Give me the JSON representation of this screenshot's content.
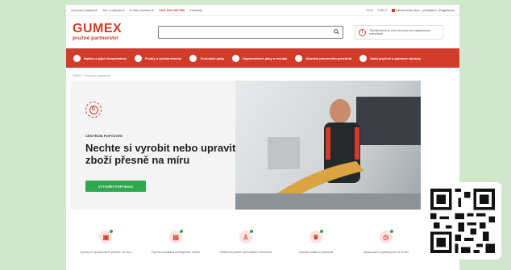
{
  "topbar": {
    "links": [
      "Centrum poptávek",
      "Vše o nákupu ▾",
      "O nás a kariéra ▾"
    ],
    "phone": "+420 518 399 588",
    "contact": "Kontakty",
    "lang": "CZ ▾",
    "currency": "CZK ▾",
    "account": "Zákaznická zóna - přihlášení | Registrace"
  },
  "header": {
    "logo_main": "GUMEX",
    "logo_sub": "pružné partnerství",
    "search_placeholder": "",
    "notice": "Tlačítka zboží je plně za pucze pro registrované pobočkách"
  },
  "nav": [
    {
      "label": "Hadice a jejich komplektace",
      "icon": "hose-icon"
    },
    {
      "label": "Profily a výroba těsnění",
      "icon": "profile-icon"
    },
    {
      "label": "Technické pláty",
      "icon": "sheet-icon"
    },
    {
      "label": "Dopravníkové pásy a montáž",
      "icon": "conveyor-icon"
    },
    {
      "label": "Obuvání pracovního prostředí",
      "icon": "workwear-icon"
    },
    {
      "label": "Další pryžové a plastové výrobky",
      "icon": "rubber-icon"
    }
  ],
  "breadcrumb": "Domů / Centrum poptávek",
  "hero": {
    "badge": "G",
    "kicker": "CENTRUM POPTÁVEK",
    "title": "Nechte si vyrobit nebo upravit zboží přesně na míru",
    "cta": "VYTVOŘIT POPTÁVKU"
  },
  "features": [
    {
      "label": "Úpravy a výroba zboží přesně na míru",
      "icon": "cut-icon"
    },
    {
      "label": "Rychlá a snadná konfigurace online",
      "icon": "config-icon"
    },
    {
      "label": "Odborná pomoc specialistů a techniků",
      "icon": "expert-icon"
    },
    {
      "label": "Vysoká kvalita a přesnost",
      "icon": "quality-icon"
    },
    {
      "label": "Zpracování poptávky do 24 hodin",
      "icon": "clock-icon"
    }
  ],
  "colors": {
    "brand_red": "#d23a2a",
    "cta_green": "#2fa84f",
    "outer_bg": "#cfe8cc"
  }
}
